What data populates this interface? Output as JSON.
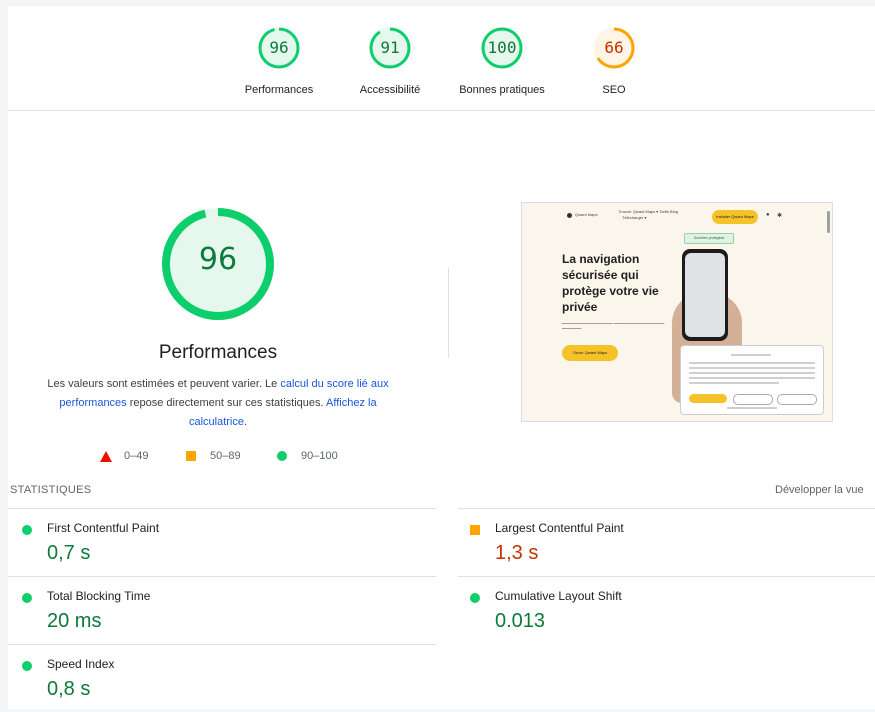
{
  "gauges": [
    {
      "score": "96",
      "label": "Performances",
      "color": "#0cce6b",
      "fill": 0.96
    },
    {
      "score": "91",
      "label": "Accessibilité",
      "color": "#0cce6b",
      "fill": 0.91
    },
    {
      "score": "100",
      "label": "Bonnes pratiques",
      "color": "#0cce6b",
      "fill": 1.0
    },
    {
      "score": "66",
      "label": "SEO",
      "color": "#ffa400",
      "fill": 0.66
    }
  ],
  "main": {
    "score": "96",
    "title": "Performances",
    "desc_part1": "Les valeurs sont estimées et peuvent varier. Le ",
    "desc_link1": "calcul du score lié aux performances",
    "desc_part2": " repose directement sur ces statistiques. ",
    "desc_link2": "Affichez la calculatrice",
    "desc_part3": ".",
    "legend": {
      "fail": "0–49",
      "average": "50–89",
      "pass": "90–100"
    }
  },
  "thumbnail": {
    "brand": "Qwant Maps",
    "nav_links": "Trouver Qwant Maps ▾   Tarifs   Blog",
    "nav_sub": "Télécharger ▾",
    "nav_button": "Installer Qwant Maps",
    "badge": "Données protégées",
    "headline": "La navigation sécurisée qui protège votre vie privée",
    "cta": "Ouvrir Qwant Maps"
  },
  "stats": {
    "title": "STATISTIQUES",
    "expand_label": "Développer la vue",
    "metrics": [
      {
        "name": "First Contentful Paint",
        "value": "0,7 s",
        "status": "pass"
      },
      {
        "name": "Largest Contentful Paint",
        "value": "1,3 s",
        "status": "average"
      },
      {
        "name": "Total Blocking Time",
        "value": "20 ms",
        "status": "pass"
      },
      {
        "name": "Cumulative Layout Shift",
        "value": "0.013",
        "status": "pass"
      },
      {
        "name": "Speed Index",
        "value": "0,8 s",
        "status": "pass"
      }
    ]
  },
  "colors": {
    "pass": "#0cce6b",
    "average": "#ffa400",
    "fail": "#eb0f00",
    "pass_text": "#0c7a3a",
    "average_text": "#c33300",
    "link": "#1a56d6"
  }
}
